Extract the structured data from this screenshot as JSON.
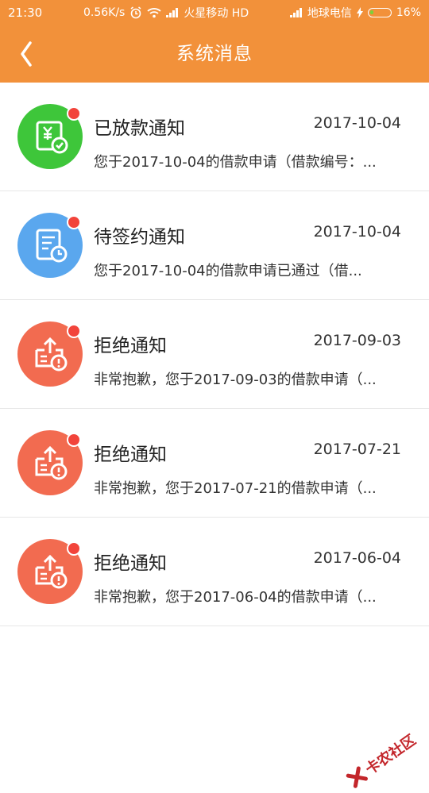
{
  "status_bar": {
    "time": "21:30",
    "speed": "0.56K/s",
    "carrier1": "火星移动 HD",
    "carrier2": "地球电信",
    "battery": "16%"
  },
  "header": {
    "title": "系统消息"
  },
  "messages": [
    {
      "title": "已放款通知",
      "date": "2017-10-04",
      "preview": "您于2017-10-04的借款申请（借款编号：...",
      "icon": "loan-disbursed-icon",
      "color": "#3ec63a",
      "unread": true
    },
    {
      "title": "待签约通知",
      "date": "2017-10-04",
      "preview": "您于2017-10-04的借款申请已通过（借...",
      "icon": "pending-contract-icon",
      "color": "#5aa7ee",
      "unread": true
    },
    {
      "title": "拒绝通知",
      "date": "2017-09-03",
      "preview": "非常抱歉，您于2017-09-03的借款申请（...",
      "icon": "rejection-icon",
      "color": "#f26b50",
      "unread": true
    },
    {
      "title": "拒绝通知",
      "date": "2017-07-21",
      "preview": "非常抱歉，您于2017-07-21的借款申请（...",
      "icon": "rejection-icon",
      "color": "#f26b50",
      "unread": true
    },
    {
      "title": "拒绝通知",
      "date": "2017-06-04",
      "preview": "非常抱歉，您于2017-06-04的借款申请（...",
      "icon": "rejection-icon",
      "color": "#f26b50",
      "unread": true
    }
  ],
  "watermark": {
    "text": "卡农社区"
  }
}
